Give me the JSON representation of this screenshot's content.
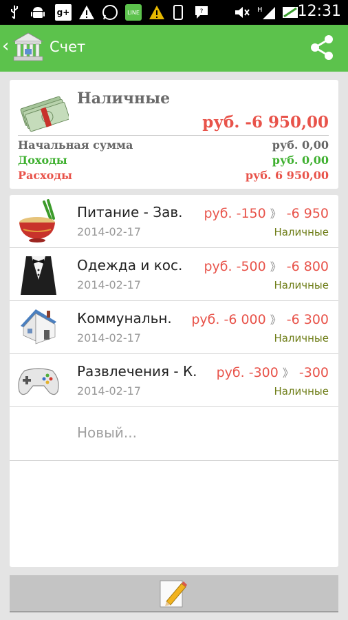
{
  "status_bar": {
    "time": "12:31",
    "icons": [
      "usb-icon",
      "android-icon",
      "google-plus-icon",
      "warning-icon",
      "whatsapp-icon",
      "line-icon",
      "warning-icon",
      "phone-icon",
      "chat-icon",
      "mute-icon",
      "signal-icon",
      "battery-icon"
    ]
  },
  "action_bar": {
    "title": "Счет",
    "back_icon": "chevron-left-icon",
    "share_icon": "share-icon"
  },
  "account": {
    "name": "Наличные",
    "balance": "руб. -6 950,00",
    "initial_label": "Начальная сумма",
    "initial_value": "руб. 0,00",
    "income_label": "Доходы",
    "income_value": "руб. 0,00",
    "expense_label": "Расходы",
    "expense_value": "руб. 6 950,00"
  },
  "transactions": [
    {
      "name": "Питание - Зав.",
      "date": "2014-02-17",
      "amount": "руб. -150",
      "running": "-6 950",
      "account": "Наличные",
      "icon": "food-bowl-icon"
    },
    {
      "name": "Одежда и кос.",
      "date": "2014-02-17",
      "amount": "руб. -500",
      "running": "-6 800",
      "account": "Наличные",
      "icon": "tuxedo-icon"
    },
    {
      "name": "Коммунальн.",
      "date": "2014-02-17",
      "amount": "руб. -6 000",
      "running": "-6 300",
      "account": "Наличные",
      "icon": "house-icon"
    },
    {
      "name": "Развлечения - К.",
      "date": "2014-02-17",
      "amount": "руб. -300",
      "running": "-300",
      "account": "Наличные",
      "icon": "gamepad-icon"
    }
  ],
  "arrow_glyph": "》",
  "new_label": "Новый...",
  "colors": {
    "accent": "#5cc24c",
    "expense": "#e8534a",
    "income": "#3fb030",
    "account_tag": "#6e7d17"
  }
}
